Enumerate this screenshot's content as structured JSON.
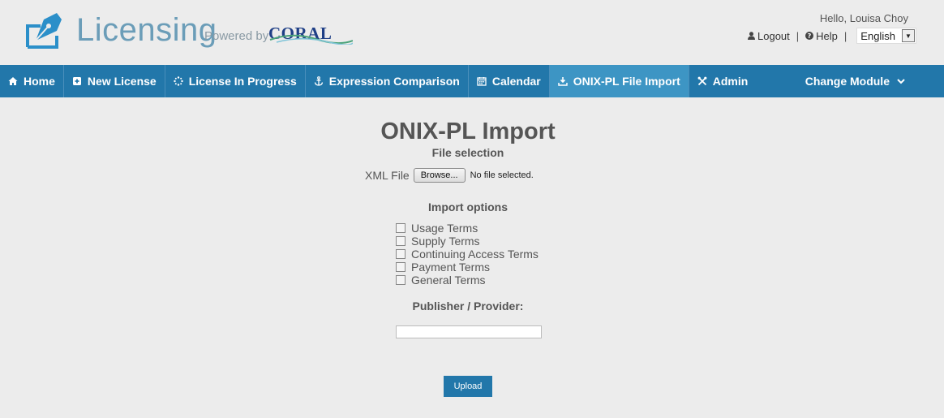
{
  "header": {
    "app_name": "Licensing",
    "powered_by": "Powered by",
    "coral_logo_text": "CORAL",
    "greeting": "Hello, Louisa Choy",
    "logout": "Logout",
    "help": "Help",
    "separator": "|",
    "language": "English"
  },
  "nav": {
    "items": [
      {
        "label": "Home",
        "icon": "home-icon"
      },
      {
        "label": "New License",
        "icon": "plus-square-icon"
      },
      {
        "label": "License In Progress",
        "icon": "spinner-icon"
      },
      {
        "label": "Expression Comparison",
        "icon": "anchor-icon"
      },
      {
        "label": "Calendar",
        "icon": "calendar-icon"
      },
      {
        "label": "ONIX-PL File Import",
        "icon": "download-icon",
        "active": true
      },
      {
        "label": "Admin",
        "icon": "tools-icon"
      }
    ],
    "change_module": "Change Module"
  },
  "main": {
    "title": "ONIX-PL Import",
    "file_selection": "File selection",
    "xml_file_label": "XML File",
    "browse_label": "Browse...",
    "no_file": "No file selected.",
    "import_options_heading": "Import options",
    "options": [
      "Usage Terms",
      "Supply Terms",
      "Continuing Access Terms",
      "Payment Terms",
      "General Terms"
    ],
    "publisher_label": "Publisher / Provider:",
    "publisher_value": "",
    "upload_label": "Upload"
  },
  "colors": {
    "nav_bg": "#2277aa",
    "nav_active": "#3d95c4",
    "brand": "#6b9db8",
    "page_bg": "#ececec"
  }
}
